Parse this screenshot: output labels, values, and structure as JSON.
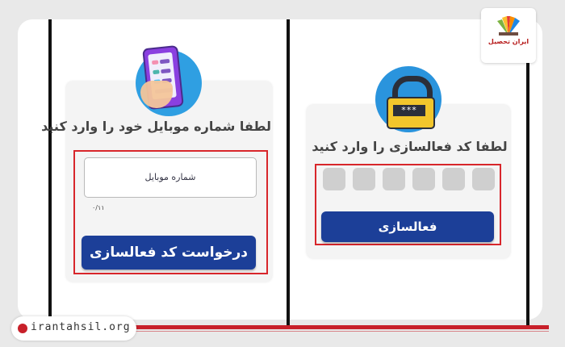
{
  "left_screen": {
    "title": "لطفا شماره موبایل خود را وارد کنید",
    "mobile_placeholder": "شماره موبایل",
    "char_counter": "۰/۱۱",
    "request_button": "درخواست کد فعالسازی"
  },
  "right_screen": {
    "title": "لطفا کد فعالسازی را وارد کنید",
    "lock_text": "***",
    "otp_boxes": [
      "",
      "",
      "",
      "",
      "",
      ""
    ],
    "activate_button": "فعالسازی"
  },
  "branding": {
    "logo_text": "ایران تحصیل",
    "site": "irantahsil.org"
  },
  "colors": {
    "button": "#1c3f98",
    "highlight": "#d8262b",
    "icon_circle": "#2f9fe2",
    "brand": "#c8202a"
  }
}
